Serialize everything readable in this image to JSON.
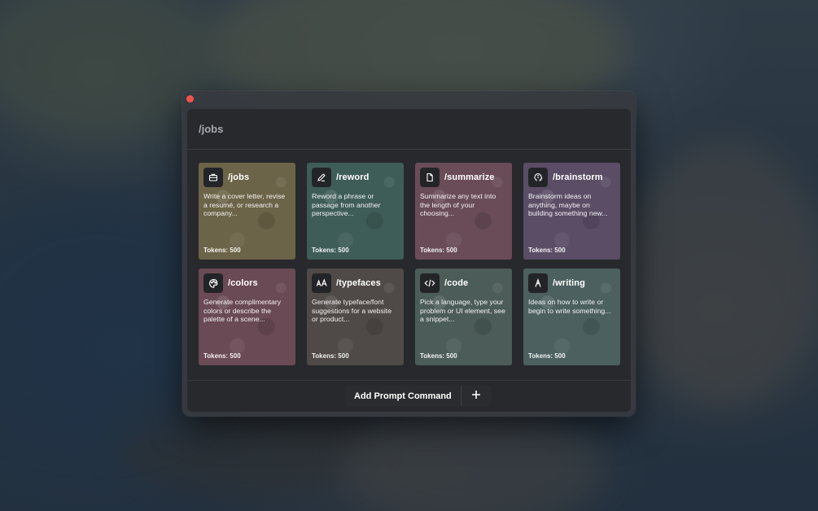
{
  "search": {
    "value": "/jobs",
    "placeholder": ""
  },
  "commands": [
    {
      "title": "/jobs",
      "description": "Write a cover letter, revise a resumé, or research a company...",
      "tokens": "Tokens: 500",
      "icon": "briefcase-icon",
      "color": "#6c6448"
    },
    {
      "title": "/reword",
      "description": "Reword a phrase or passage from another perspective...",
      "tokens": "Tokens: 500",
      "icon": "pencil-icon",
      "color": "#3f5d58"
    },
    {
      "title": "/summarize",
      "description": "Summarize any text into the length of your choosing...",
      "tokens": "Tokens: 500",
      "icon": "document-icon",
      "color": "#6a4c59"
    },
    {
      "title": "/brainstorm",
      "description": "Brainstorm ideas on anything, maybe on building something new...",
      "tokens": "Tokens: 500",
      "icon": "brain-icon",
      "color": "#5b4d66"
    },
    {
      "title": "/colors",
      "description": "Generate complimentary colors or describe the palette of a scene...",
      "tokens": "Tokens: 500",
      "icon": "palette-icon",
      "color": "#6a4a55"
    },
    {
      "title": "/typefaces",
      "description": "Generate typeface/font suggestions for a website or product...",
      "tokens": "Tokens: 500",
      "icon": "typeface-icon",
      "color": "#4f4a47"
    },
    {
      "title": "/code",
      "description": "Pick a language, type your problem or UI element, see a snippet...",
      "tokens": "Tokens: 500",
      "icon": "code-icon",
      "color": "#4c5c58"
    },
    {
      "title": "/writing",
      "description": "Ideas on how to write or begin to write something...",
      "tokens": "Tokens: 500",
      "icon": "pen-nib-icon",
      "color": "#4c605f"
    }
  ],
  "footer": {
    "add_label": "Add Prompt Command"
  },
  "colors": {
    "close_dot": "#f1534c",
    "window_bg": "#373a40",
    "panel_bg": "#26282c"
  }
}
